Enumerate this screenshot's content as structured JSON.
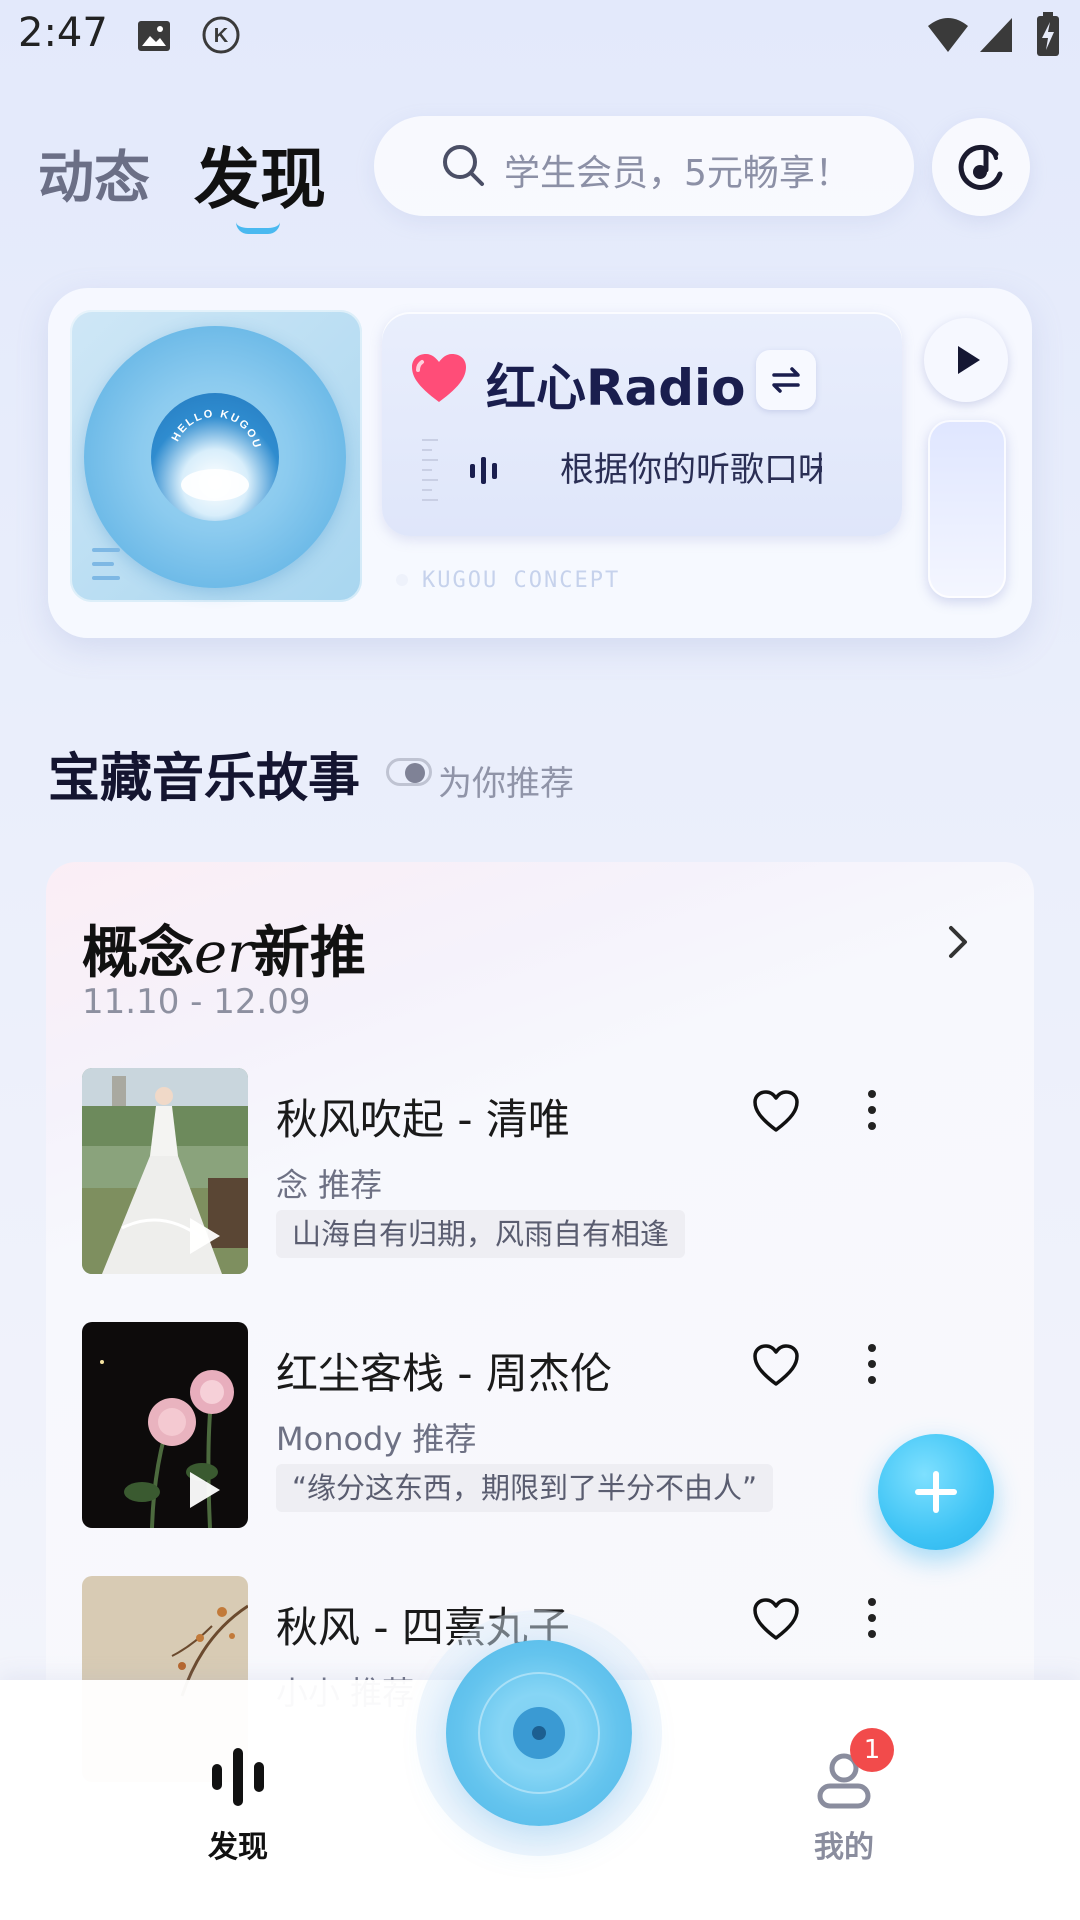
{
  "status_bar": {
    "time": "2:47"
  },
  "header": {
    "tabs": [
      {
        "label": "动态"
      },
      {
        "label": "发现"
      }
    ],
    "search_placeholder": "学生会员，5元畅享！"
  },
  "radio": {
    "title": "红心Radio",
    "subtitle": "根据你的听歌口味",
    "concept": "KUGOU CONCEPT",
    "vinyl_text": "HELLO KUGOU"
  },
  "section": {
    "title": "宝藏音乐故事",
    "toggle_label": "为你推荐"
  },
  "playlist": {
    "title_prefix": "概念",
    "title_italic": "er",
    "title_suffix": "新推",
    "date_range": "11.10 - 12.09",
    "songs": [
      {
        "title": "秋风吹起 - 清唯",
        "recommender": "念 推荐",
        "tag": "山海自有归期，风雨自有相逢"
      },
      {
        "title": "红尘客栈 - 周杰伦",
        "recommender": "Monody 推荐",
        "tag": "“缘分这东西，期限到了半分不由人”"
      },
      {
        "title": "秋风 - 四熹丸子",
        "recommender": "小小 推荐",
        "tag": ""
      }
    ]
  },
  "bottom_nav": {
    "items": [
      {
        "label": "发现"
      },
      {
        "label": "我的"
      }
    ],
    "badge_count": "1"
  },
  "colors": {
    "accent": "#3fc4f5",
    "badge": "#f24b4b",
    "heart": "#ff4d78"
  }
}
